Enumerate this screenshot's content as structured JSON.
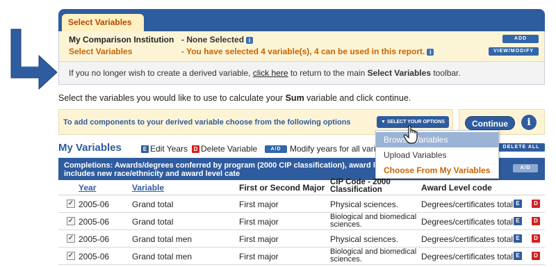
{
  "panel": {
    "tab_label": "Select Variables",
    "comparison_label": "My Comparison Institution",
    "comparison_value": "- None Selected",
    "select_label": "Select Variables",
    "select_value": "- You have selected 4 variable(s), 4 can be used in this report.",
    "add_label": "ADD",
    "view_label": "VIEW/MODIFY",
    "note_prefix": "If you no longer wish to create a derived variable,",
    "note_link": "click here",
    "note_mid": "to return to the main",
    "note_bold": "Select Variables",
    "note_suffix": "toolbar."
  },
  "instruction": {
    "prefix": "Select the variables you would like to use to calculate your",
    "bold": "Sum",
    "suffix": "variable and click continue."
  },
  "options": {
    "text": "To add components to your derived variable choose from the following options",
    "select_label": "▼ SELECT YOUR OPTIONS",
    "continue_label": "Continue",
    "info_label": "i"
  },
  "dropdown": {
    "items": [
      "Browse Variables",
      "Upload Variables",
      "Choose From My Variables"
    ]
  },
  "my_variables": {
    "title": "My Variables",
    "edit_label": "Edit Years",
    "delete_label": "Delete Variable",
    "ad_label": "A/D",
    "modify_label": "Modify years for all vari",
    "delete_all_label": "DELETE ALL",
    "e_icon": "E",
    "d_icon": "D"
  },
  "table": {
    "header": "Completions: Awards/degrees conferred by program (2000 CIP classification), award level, race/ethnicity, and gender - includes new race/ethnicity and award level cate",
    "ad_label": "A/D",
    "columns": [
      "Year",
      "Variable",
      "First or Second Major",
      "CIP Code - 2000 Classification",
      "Award Level code"
    ],
    "rows": [
      {
        "year": "2005-06",
        "variable": "Grand total",
        "major": "First major",
        "cip": "Physical sciences.",
        "award": "Degrees/certificates total"
      },
      {
        "year": "2005-06",
        "variable": "Grand total",
        "major": "First major",
        "cip": "Biological and biomedical sciences.",
        "award": "Degrees/certificates total"
      },
      {
        "year": "2005-06",
        "variable": "Grand total men",
        "major": "First major",
        "cip": "Physical sciences.",
        "award": "Degrees/certificates total"
      },
      {
        "year": "2005-06",
        "variable": "Grand total men",
        "major": "First major",
        "cip": "Biological and biomedical sciences.",
        "award": "Degrees/certificates total"
      }
    ]
  },
  "colors": {
    "brand_blue": "#2f5c9e",
    "accent_orange": "#c86400",
    "panel_cream": "#fdf4d6",
    "delete_red": "#d42020"
  }
}
